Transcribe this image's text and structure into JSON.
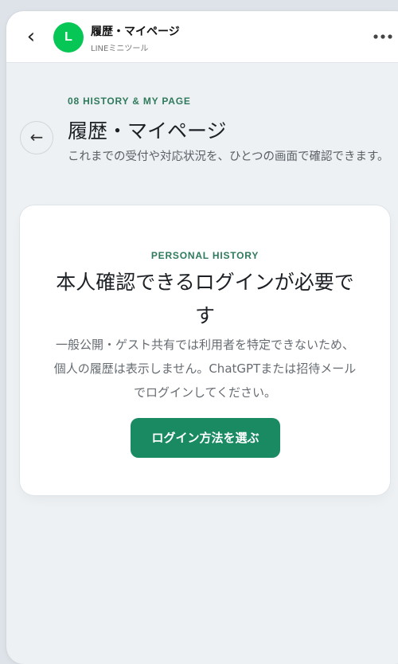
{
  "header": {
    "back_glyph": "‹",
    "avatar_letter": "L",
    "title": "履歴・マイページ",
    "subtitle": "LINEミニツール",
    "more_icon": "more-horizontal-icon"
  },
  "page": {
    "section_label": "08 HISTORY & MY PAGE",
    "back_glyph": "←",
    "title": "履歴・マイページ",
    "description": "これまでの受付や対応状況を、ひとつの画面で確認できます。"
  },
  "card": {
    "kicker": "PERSONAL HISTORY",
    "title": "本人確認できるログインが必要です",
    "body": "一般公開・ゲスト共有では利用者を特定できないため、個人の履歴は表示しません。ChatGPTまたは招待メールでログインしてください。",
    "button_label": "ログイン方法を選ぶ"
  },
  "colors": {
    "accent": "#1a8a63",
    "label_green": "#2f7a5c",
    "line_green": "#06c755",
    "background": "#eef1f3"
  }
}
